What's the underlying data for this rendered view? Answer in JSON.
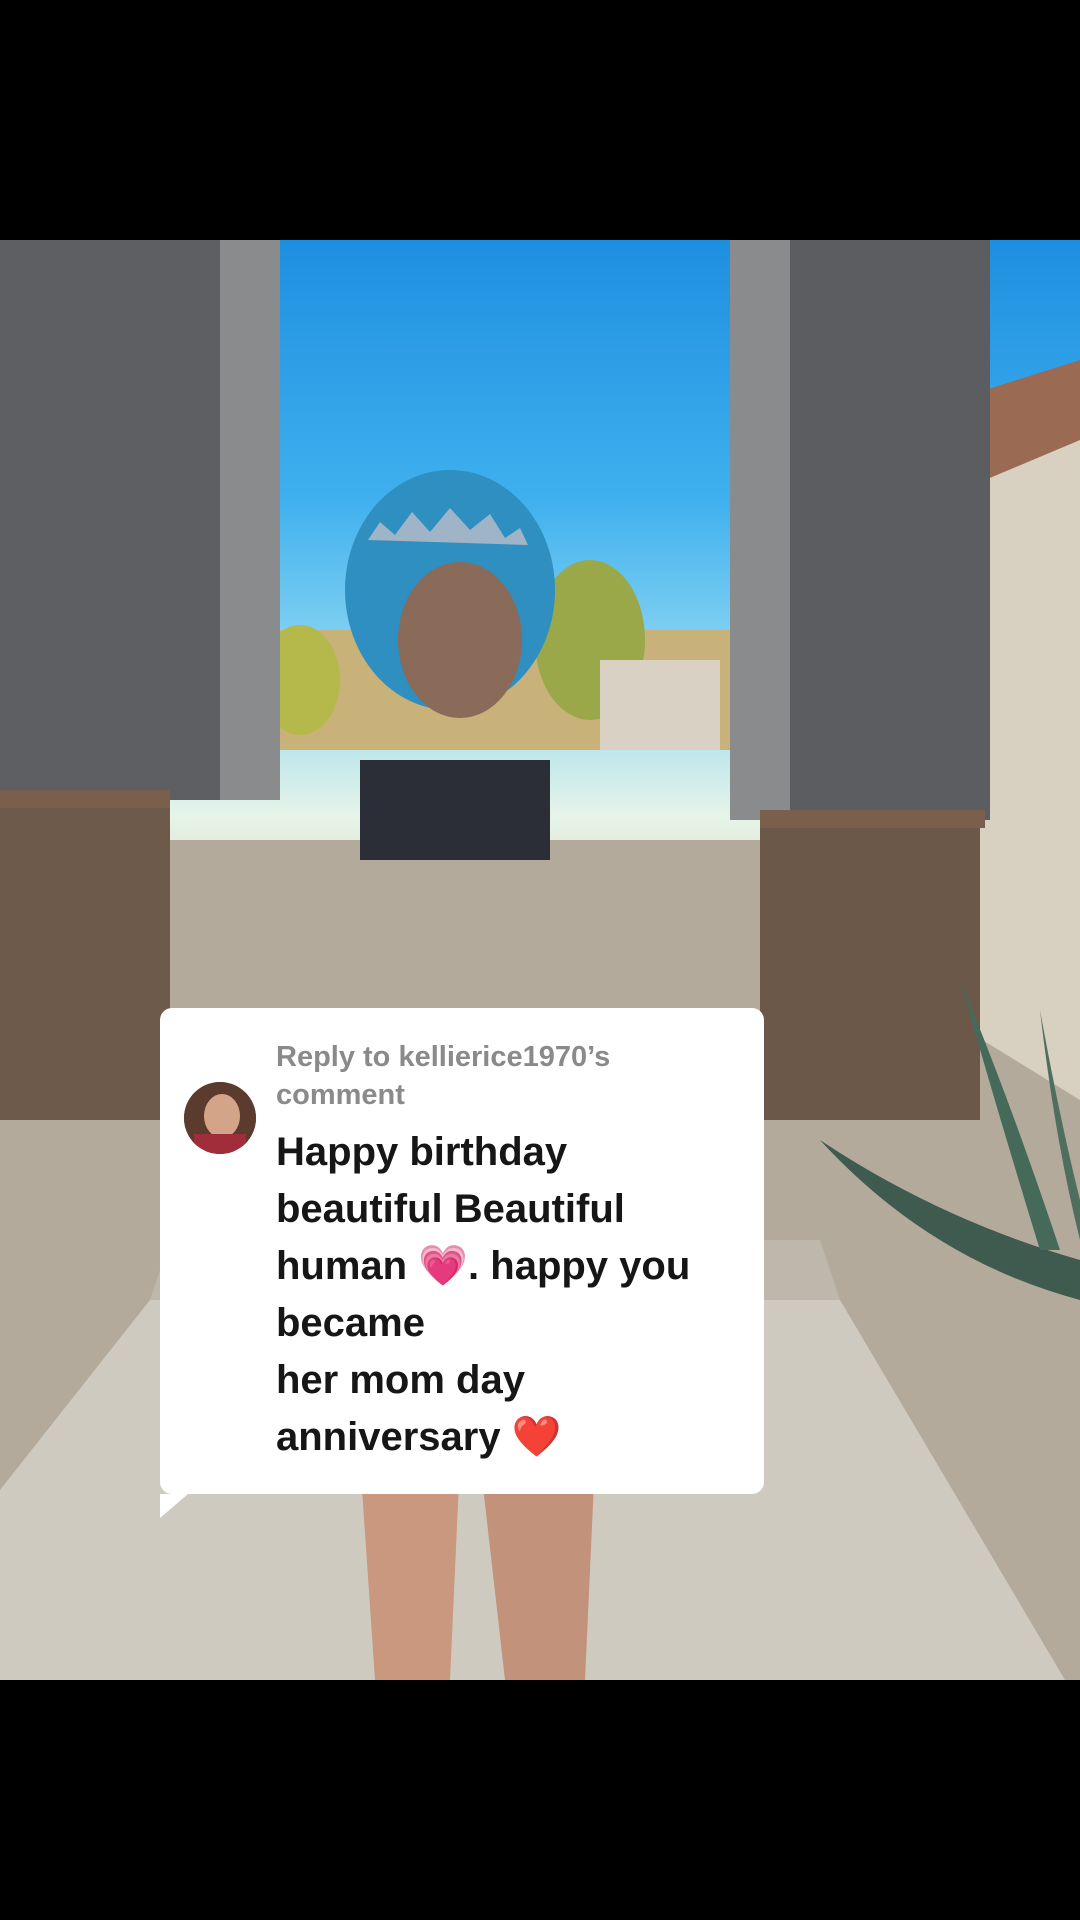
{
  "reply": {
    "header": "Reply to kellierice1970’s comment",
    "avatar_icon": "commenter-avatar",
    "text": "Happy birthday beautiful Beautiful human 💗. happy you became\nher mom day anniversary ❤️"
  },
  "colors": {
    "card_background": "#ffffff",
    "reply_header": "#8a8a8a",
    "comment_text": "#161616"
  }
}
